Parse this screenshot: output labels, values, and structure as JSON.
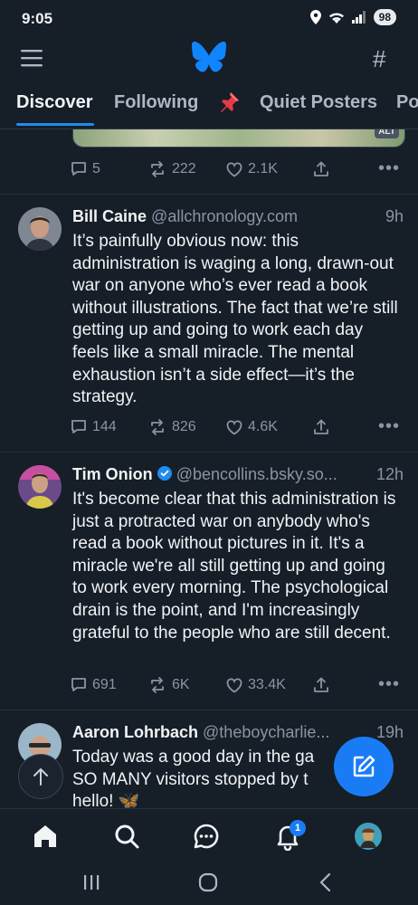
{
  "status_bar": {
    "time": "9:05",
    "battery": "98"
  },
  "header": {
    "menu_icon": "hamburger-icon",
    "logo_icon": "butterfly-logo-icon",
    "feeds_icon": "hashtag-icon"
  },
  "tabs": [
    {
      "label": "Discover",
      "active": true
    },
    {
      "label": "Following",
      "active": false
    },
    {
      "label": "",
      "icon": "pin-icon",
      "active": false
    },
    {
      "label": "Quiet Posters",
      "active": false
    },
    {
      "label": "Po",
      "active": false
    }
  ],
  "previous_post": {
    "alt_badge": "ALT",
    "replies": "5",
    "reposts": "222",
    "likes": "2.1K"
  },
  "posts": [
    {
      "author": "Bill Caine",
      "handle": "@allchronology.com",
      "time": "9h",
      "text": "It’s painfully obvious now: this administration is waging a long, drawn-out war on anyone who’s ever read a book without illustrations. The fact that we’re still getting up and going to work each day feels like a small miracle. The mental exhaustion isn’t a side effect—it’s the strategy.",
      "replies": "144",
      "reposts": "826",
      "likes": "4.6K"
    },
    {
      "author": "Tim Onion",
      "verified": true,
      "handle": "@bencollins.bsky.so...",
      "time": "12h",
      "text": "It's become clear that this administration is just a protracted war on anybody who's read a book without pictures in it. It's a miracle we're all still getting up and going to work every morning. The psychological drain is the point, and I'm increasingly grateful to the people who are still decent.",
      "replies": "691",
      "reposts": "6K",
      "likes": "33.4K"
    },
    {
      "author": "Aaron Lohrbach",
      "handle": "@theboycharlie...",
      "time": "19h",
      "text": "Today was a good day in the ga... SO MANY visitors stopped by t... hello! 🦋",
      "line1": "Today was a good day in the ga",
      "line2": "SO MANY visitors stopped by t",
      "line3": "hello! 🦋"
    }
  ],
  "notifications_count": "1",
  "colors": {
    "accent": "#1f8cf0",
    "background": "#161e27",
    "muted": "#8796a6"
  }
}
